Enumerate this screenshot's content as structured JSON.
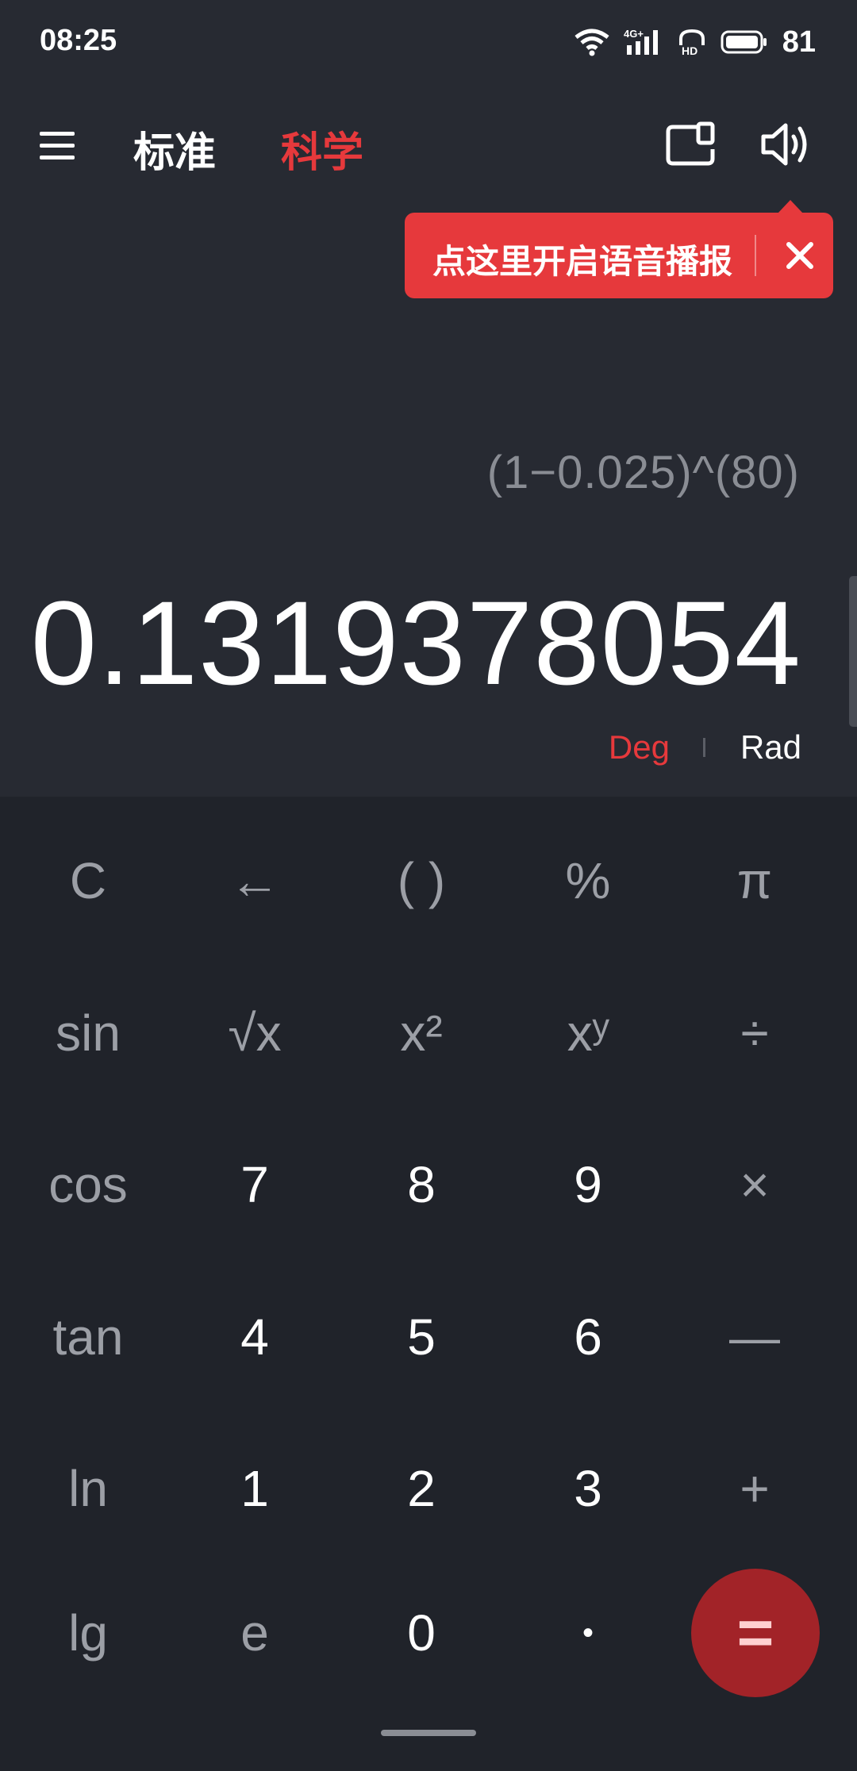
{
  "status_bar": {
    "time": "08:25",
    "network": "4G",
    "signal_hd": "HD",
    "battery": "81"
  },
  "header": {
    "tab_standard": "标准",
    "tab_scientific": "科学"
  },
  "tooltip": {
    "text": "点这里开启语音播报"
  },
  "display": {
    "expression": "(1−0.025)^(80)",
    "result": "0.1319378054",
    "deg": "Deg",
    "rad": "Rad"
  },
  "keys": {
    "row1": [
      "C",
      "←",
      "( )",
      "%",
      "π"
    ],
    "row2": [
      "sin",
      "√x",
      "x²",
      "xʸ",
      "÷"
    ],
    "row3": [
      "cos",
      "7",
      "8",
      "9",
      "×"
    ],
    "row4": [
      "tan",
      "4",
      "5",
      "6",
      "—"
    ],
    "row5": [
      "ln",
      "1",
      "2",
      "3",
      "+"
    ],
    "row6": [
      "lg",
      "e",
      "0",
      "•",
      "="
    ]
  },
  "colors": {
    "accent": "#e6393c",
    "background": "#272a32",
    "keypad": "#20232a",
    "equals": "#a22328"
  }
}
